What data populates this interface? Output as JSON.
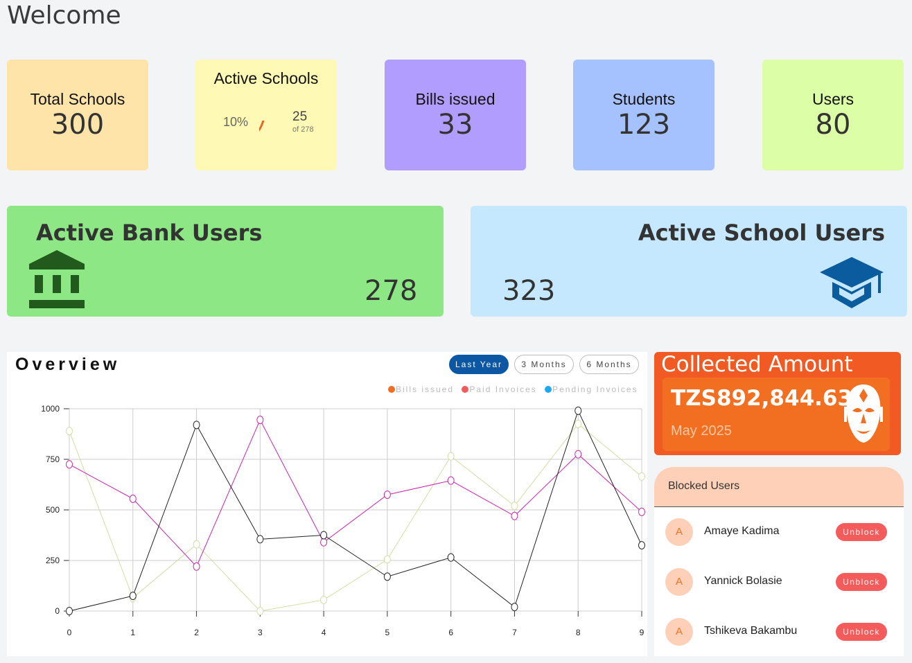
{
  "page_title": "Welcome",
  "stats": {
    "total_schools": {
      "label": "Total Schools",
      "value": "300"
    },
    "active_schools": {
      "label": "Active Schools",
      "percent": "10%",
      "count": "25",
      "of_total": "of 278",
      "fraction": 0.1
    },
    "bills_issued": {
      "label": "Bills issued",
      "value": "33"
    },
    "students": {
      "label": "Students",
      "value": "123"
    },
    "users": {
      "label": "Users",
      "value": "80"
    }
  },
  "bank_users": {
    "title": "Active Bank Users",
    "value": "278",
    "icon": "bank-icon"
  },
  "school_users": {
    "title": "Active School Users",
    "value": "323",
    "icon": "graduation-cap-icon"
  },
  "overview": {
    "title": "Overview",
    "filters": [
      "Last Year",
      "3 Months",
      "6 Months"
    ],
    "active_filter": "Last Year",
    "legend": [
      "Bills issued",
      "Paid Invoices",
      "Pending Invoices"
    ],
    "legend_colors": [
      "#f26f21",
      "#f45b5b",
      "#1ea7f5"
    ]
  },
  "chart_data": {
    "type": "line",
    "x": [
      0,
      1,
      2,
      3,
      4,
      5,
      6,
      7,
      8,
      9
    ],
    "ylim": [
      0,
      1000
    ],
    "yticks": [
      0,
      250,
      500,
      750,
      1000
    ],
    "series": [
      {
        "name": "Bills issued",
        "color": "#222222",
        "values": [
          0,
          75,
          920,
          355,
          375,
          170,
          265,
          20,
          990,
          325
        ]
      },
      {
        "name": "Paid Invoices",
        "color": "#cc22aa",
        "values": [
          725,
          555,
          220,
          945,
          340,
          575,
          645,
          470,
          775,
          490
        ]
      },
      {
        "name": "Pending Invoices",
        "color": "#d6dca0",
        "values": [
          890,
          65,
          330,
          0,
          55,
          255,
          765,
          520,
          925,
          665
        ]
      }
    ]
  },
  "collected": {
    "title": "Collected Amount",
    "amount": "TZS892,844.63",
    "period": "May 2025",
    "icon": "mask-icon"
  },
  "blocked_users": {
    "title": "Blocked Users",
    "action_label": "Unblock",
    "users": [
      {
        "initial": "A",
        "name": "Amaye Kadima"
      },
      {
        "initial": "A",
        "name": "Yannick Bolasie"
      },
      {
        "initial": "A",
        "name": "Tshikeva Bakambu"
      }
    ]
  }
}
